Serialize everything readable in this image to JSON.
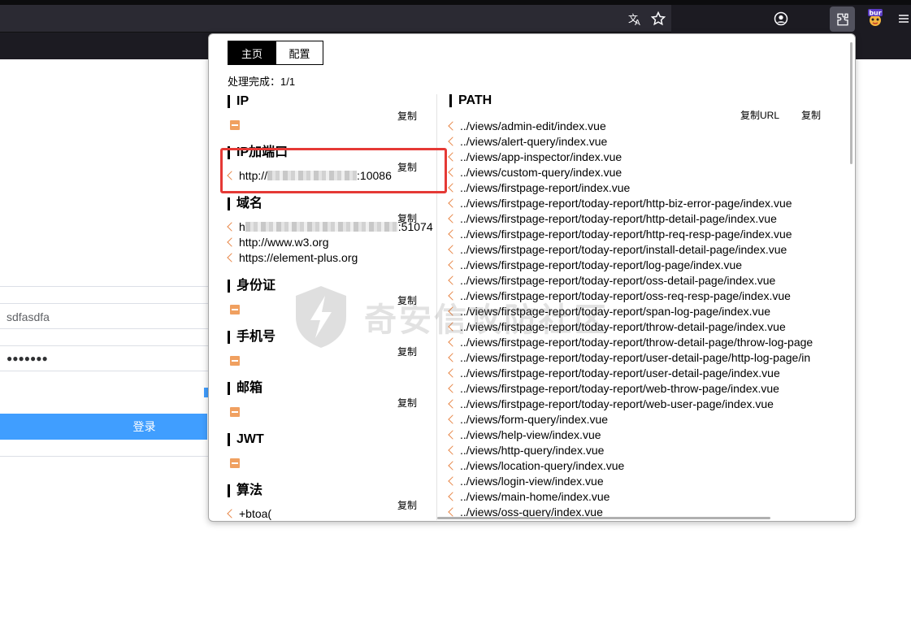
{
  "browser": {
    "toolbar_icons": [
      "translate-icon",
      "bookmark-star-icon",
      "account-icon",
      "extensions-icon",
      "burp-extension-icon",
      "menu-icon"
    ],
    "burp_badge": "bur"
  },
  "login_page": {
    "username_value": "sdfasdfa",
    "password_value": "●●●●●●●",
    "login_button": "登录"
  },
  "popup": {
    "tabs": [
      {
        "label": "主页",
        "active": true
      },
      {
        "label": "配置",
        "active": false
      }
    ],
    "status": "处理完成：1/1",
    "copy_label": "复制",
    "copy_url_label": "复制URL",
    "sections": {
      "ip": {
        "title": "IP"
      },
      "ip_port": {
        "title": "IP加端口",
        "items": [
          {
            "prefix": "http://",
            "suffix": ":10086"
          }
        ]
      },
      "domain": {
        "title": "域名",
        "items": [
          {
            "prefix": "h",
            "suffix": ":51074"
          },
          {
            "text": "http://www.w3.org"
          },
          {
            "text": "https://element-plus.org"
          }
        ]
      },
      "id_card": {
        "title": "身份证"
      },
      "phone": {
        "title": "手机号"
      },
      "email": {
        "title": "邮箱"
      },
      "jwt": {
        "title": "JWT"
      },
      "algorithm": {
        "title": "算法",
        "items": [
          {
            "text": "+btoa("
          }
        ]
      }
    },
    "path": {
      "title": "PATH",
      "items": [
        "../views/admin-edit/index.vue",
        "../views/alert-query/index.vue",
        "../views/app-inspector/index.vue",
        "../views/custom-query/index.vue",
        "../views/firstpage-report/index.vue",
        "../views/firstpage-report/today-report/http-biz-error-page/index.vue",
        "../views/firstpage-report/today-report/http-detail-page/index.vue",
        "../views/firstpage-report/today-report/http-req-resp-page/index.vue",
        "../views/firstpage-report/today-report/install-detail-page/index.vue",
        "../views/firstpage-report/today-report/log-page/index.vue",
        "../views/firstpage-report/today-report/oss-detail-page/index.vue",
        "../views/firstpage-report/today-report/oss-req-resp-page/index.vue",
        "../views/firstpage-report/today-report/span-log-page/index.vue",
        "../views/firstpage-report/today-report/throw-detail-page/index.vue",
        "../views/firstpage-report/today-report/throw-detail-page/throw-log-page",
        "../views/firstpage-report/today-report/user-detail-page/http-log-page/in",
        "../views/firstpage-report/today-report/user-detail-page/index.vue",
        "../views/firstpage-report/today-report/web-throw-page/index.vue",
        "../views/firstpage-report/today-report/web-user-page/index.vue",
        "../views/form-query/index.vue",
        "../views/help-view/index.vue",
        "../views/http-query/index.vue",
        "../views/location-query/index.vue",
        "../views/login-view/index.vue",
        "../views/main-home/index.vue",
        "../views/oss-query/index.vue"
      ]
    }
  },
  "watermark": {
    "text": "奇安信攻防社区"
  },
  "colors": {
    "accent_orange": "#e8884a",
    "highlight_red": "#e53935",
    "login_blue": "#409eff"
  }
}
